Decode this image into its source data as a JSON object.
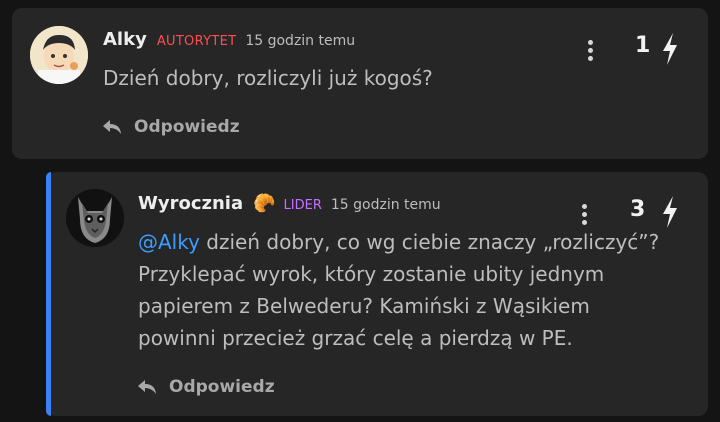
{
  "comments": [
    {
      "author": "Alky",
      "role": "AUTORYTET",
      "time": "15 godzin temu",
      "text": "Dzień dobry, rozliczyli już kogoś?",
      "votes": "1",
      "reply_label": "Odpowiedz"
    },
    {
      "author": "Wyrocznia",
      "badge_emoji": "🥐",
      "role": "LIDER",
      "time": "15 godzin temu",
      "mention": "@Alky",
      "text_line1": " dzień dobry, co wg ciebie znaczy „rozliczyć”?",
      "text_line2": "Przyklepać wyrok, który zostanie ubity jednym",
      "text_line3": "papierem z Belwederu? Kamiński z Wąsikiem",
      "text_line4": "powinni przecież grzać celę a pierdzą w PE.",
      "votes": "3",
      "reply_label": "Odpowiedz"
    }
  ],
  "colors": {
    "background": "#141414",
    "card": "#262626",
    "accent_bar": "#3b82f6",
    "mention": "#3b9dff",
    "role_autorytet": "#ff4d4d",
    "role_lider": "#c470ff"
  },
  "icons": [
    "more-vertical-icon",
    "lightning-bolt-icon",
    "reply-arrow-icon"
  ]
}
